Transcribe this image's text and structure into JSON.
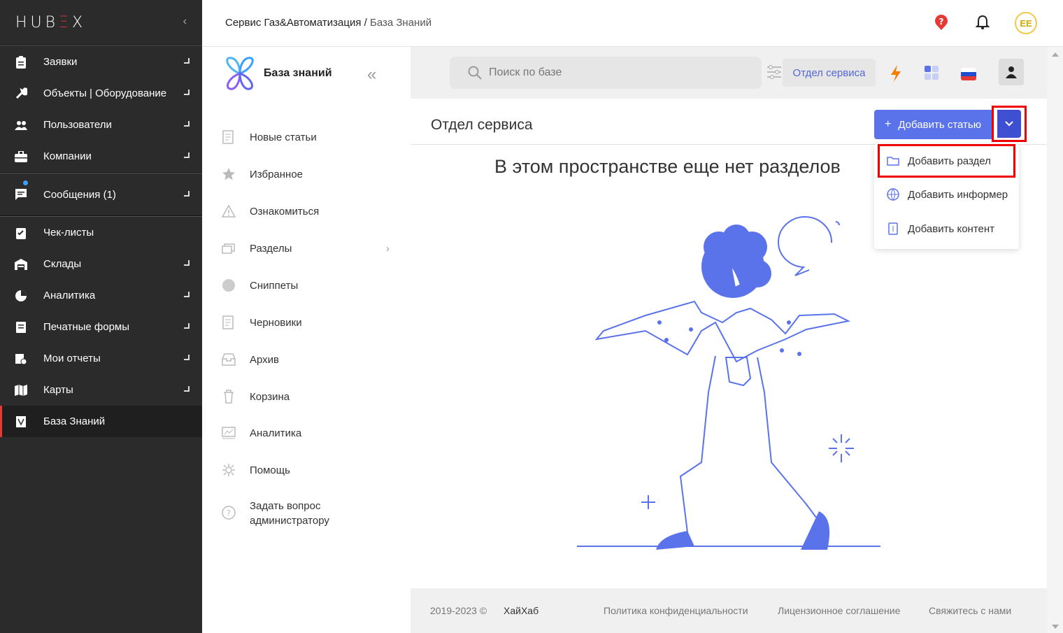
{
  "brand": {
    "logo_a": "HUB",
    "logo_b": "Ξ",
    "logo_c": "X"
  },
  "sidebar": {
    "groups": [
      [
        {
          "label": "Заявки",
          "icon": "clipboard-icon"
        },
        {
          "label": "Объекты | Оборудование",
          "icon": "wrench-icon"
        },
        {
          "label": "Пользователи",
          "icon": "users-icon"
        },
        {
          "label": "Компании",
          "icon": "briefcase-icon"
        }
      ],
      [
        {
          "label": "Сообщения (1)",
          "icon": "message-icon"
        }
      ],
      [
        {
          "label": "Чек-листы",
          "icon": "checklist-icon"
        },
        {
          "label": "Склады",
          "icon": "warehouse-icon"
        },
        {
          "label": "Аналитика",
          "icon": "pie-chart-icon"
        },
        {
          "label": "Печатные формы",
          "icon": "print-form-icon"
        },
        {
          "label": "Мои отчеты",
          "icon": "reports-icon"
        },
        {
          "label": "Карты",
          "icon": "map-icon"
        },
        {
          "label": "База Знаний",
          "icon": "knowledge-base-icon"
        }
      ]
    ]
  },
  "header": {
    "breadcrumb_root": "Сервис Газ&Автоматизация",
    "breadcrumb_sep": " / ",
    "breadcrumb_current": "База Знаний",
    "avatar_initials": "ЕЕ"
  },
  "kb": {
    "title": "База знаний",
    "items": [
      {
        "label": "Новые статьи",
        "icon": "new-articles-icon"
      },
      {
        "label": "Избранное",
        "icon": "star-icon"
      },
      {
        "label": "Ознакомиться",
        "icon": "warning-icon"
      },
      {
        "label": "Разделы",
        "icon": "sections-icon"
      },
      {
        "label": "Сниппеты",
        "icon": "snippets-icon"
      },
      {
        "label": "Черновики",
        "icon": "drafts-icon"
      },
      {
        "label": "Архив",
        "icon": "archive-icon"
      },
      {
        "label": "Корзина",
        "icon": "trash-icon"
      },
      {
        "label": "Аналитика",
        "icon": "analytics-icon"
      },
      {
        "label": "Помощь",
        "icon": "help-icon"
      },
      {
        "label": "Задать вопрос администратору",
        "icon": "question-icon"
      }
    ]
  },
  "search": {
    "placeholder": "Поиск по базе"
  },
  "toolbar": {
    "department": "Отдел сервиса"
  },
  "panel": {
    "title": "Отдел сервиса",
    "add_article": "Добавить статью",
    "empty_message": "В этом пространстве еще нет разделов"
  },
  "menu": {
    "add_section": "Добавить раздел",
    "add_informer": "Добавить информер",
    "add_content": "Добавить контент"
  },
  "footer": {
    "copyright": "2019-2023 ©",
    "company": "ХайХаб",
    "privacy": "Политика конфиденциальности",
    "license": "Лицензионное соглашение",
    "contact": "Свяжитесь с нами"
  },
  "colors": {
    "accent": "#5b73ea",
    "accent_dark": "#3f4fd1",
    "sidebar_bg": "#2b2b2b",
    "highlight": "#e00000",
    "brand_red": "#e53935"
  }
}
